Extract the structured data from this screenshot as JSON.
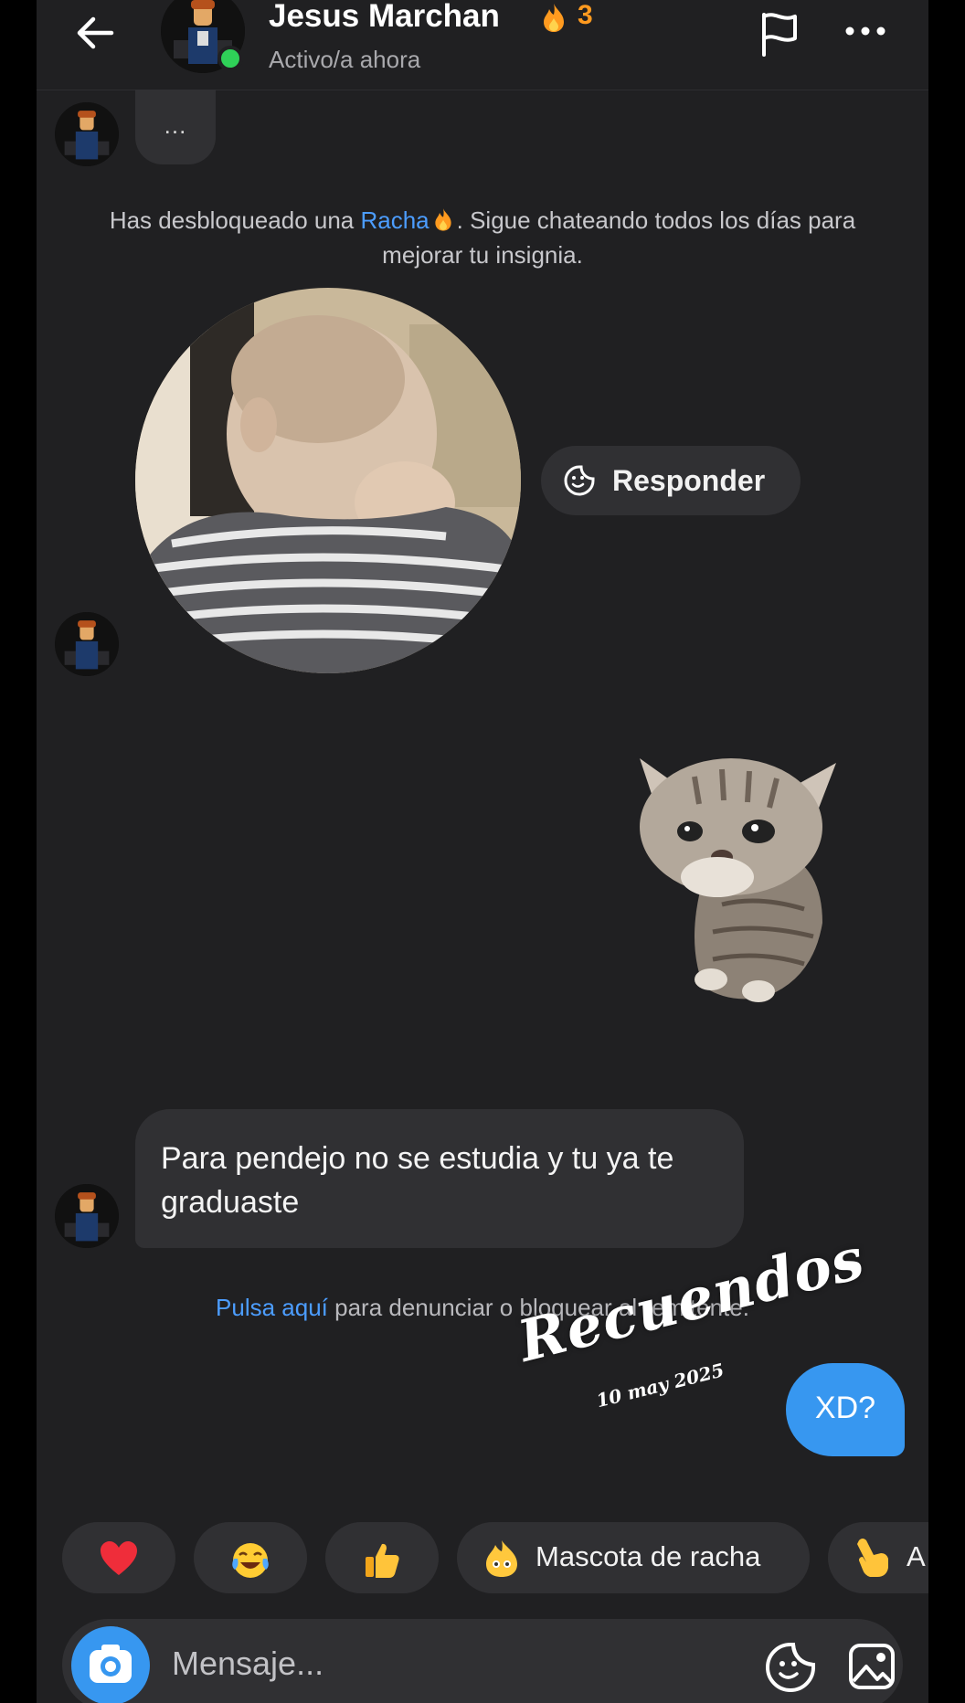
{
  "header": {
    "back_icon": "arrow-left-icon",
    "contact_name": "Jesus Marchan",
    "streak_icon": "fire-icon",
    "streak_count": "3",
    "presence": "Activo/a ahora",
    "flag_icon": "flag-icon",
    "more_icon": "more-horizontal-icon",
    "online_color": "#2fd158"
  },
  "thread": {
    "typing_bubble": "...",
    "streak_notice": {
      "before": "Has desbloqueado una ",
      "link": "Racha",
      "after": ". Sigue chateando todos los días para mejorar tu insignia."
    },
    "reply_button": "Responder",
    "received_message": "Para pendejo no se estudia y tu ya te graduaste",
    "report_notice": {
      "link": "Pulsa aquí",
      "text": " para denunciar o bloquear al remitente."
    },
    "sent_message": "XD?"
  },
  "watermark": {
    "script": "Recuendos",
    "date": "10 may 2025"
  },
  "quick_replies": [
    {
      "emoji": "heart-emoji"
    },
    {
      "emoji": "laughing-tears-emoji"
    },
    {
      "emoji": "thumbs-up-emoji"
    },
    {
      "emoji": "streak-pet-emoji",
      "label": "Mascota de racha"
    },
    {
      "emoji": "pointing-hand-emoji",
      "label": "A"
    }
  ],
  "composer": {
    "camera_icon": "camera-icon",
    "placeholder": "Mensaje...",
    "sticker_icon": "sticker-icon",
    "gallery_icon": "gallery-icon"
  },
  "colors": {
    "background": "#202022",
    "bubble": "#303033",
    "accent_blue": "#3797f0",
    "link_blue": "#4c9dff",
    "streak_orange": "#ff9a1f"
  }
}
